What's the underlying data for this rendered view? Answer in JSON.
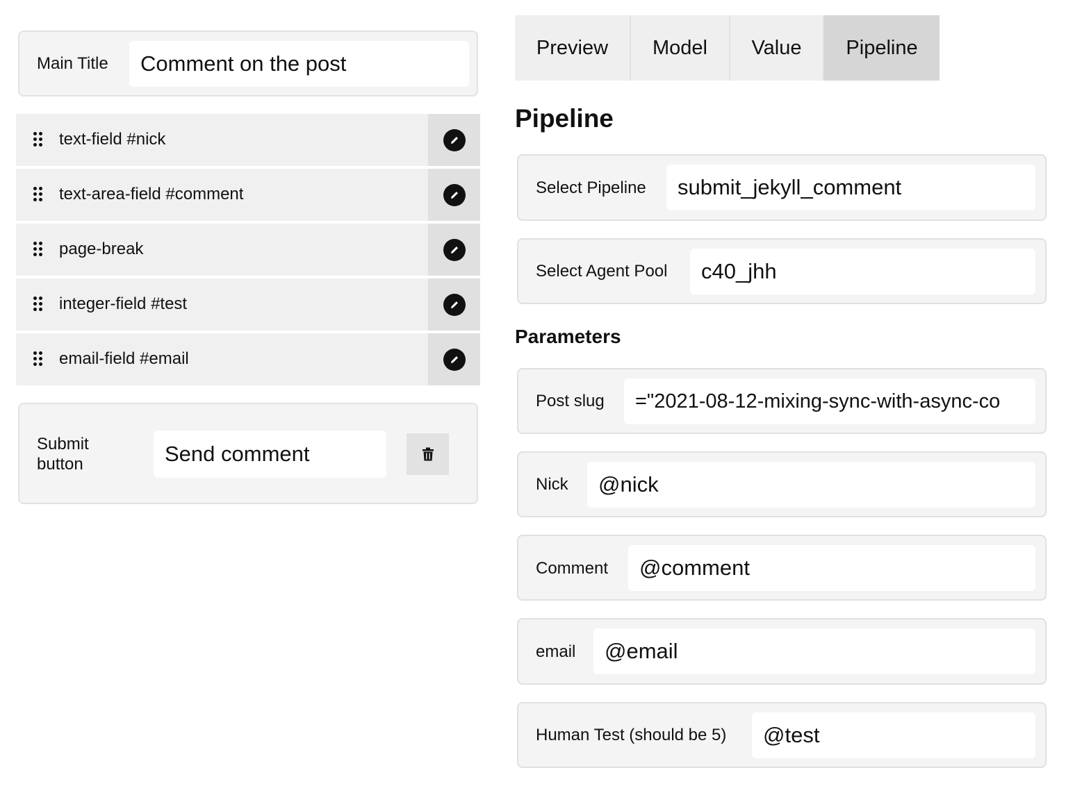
{
  "form": {
    "main_title_label": "Main Title",
    "main_title_value": "Comment on the post",
    "fields": [
      {
        "label": "text-field #nick"
      },
      {
        "label": "text-area-field #comment"
      },
      {
        "label": "page-break"
      },
      {
        "label": "integer-field #test"
      },
      {
        "label": "email-field #email"
      }
    ],
    "submit_label_line1": "Submit",
    "submit_label_line2": "button",
    "submit_value": "Send comment"
  },
  "tabs": [
    {
      "label": "Preview",
      "active": false
    },
    {
      "label": "Model",
      "active": false
    },
    {
      "label": "Value",
      "active": false
    },
    {
      "label": "Pipeline",
      "active": true
    }
  ],
  "pipeline": {
    "heading": "Pipeline",
    "select_pipeline_label": "Select Pipeline",
    "select_pipeline_value": "submit_jekyll_comment",
    "agent_pool_label": "Select Agent Pool",
    "agent_pool_value": "c40_jhh",
    "parameters_heading": "Parameters",
    "parameters": [
      {
        "label": "Post slug",
        "value": "=\"2021-08-12-mixing-sync-with-async-co"
      },
      {
        "label": "Nick",
        "value": "@nick"
      },
      {
        "label": "Comment",
        "value": "@comment"
      },
      {
        "label": "email",
        "value": "@email"
      },
      {
        "label": "Human Test (should be 5)",
        "value": "@test"
      }
    ]
  },
  "icons": {
    "drag": "drag-handle-icon",
    "edit": "pencil-icon",
    "delete": "trash-icon"
  }
}
